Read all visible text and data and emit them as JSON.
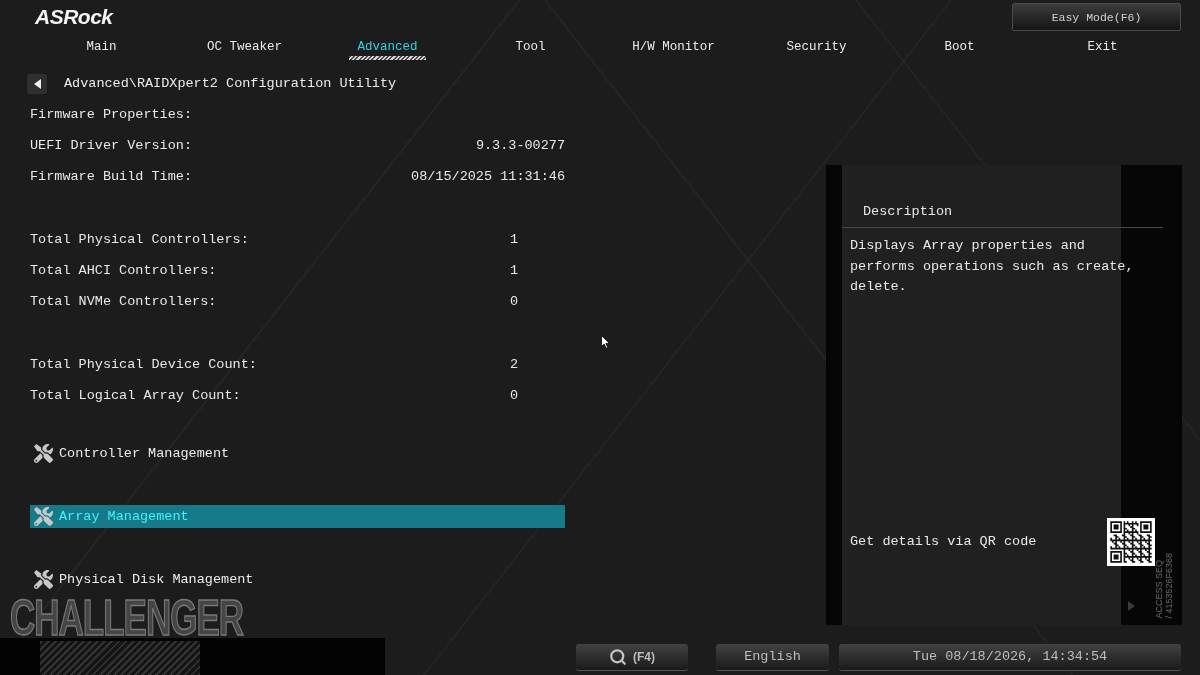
{
  "header": {
    "logo": "ASRock",
    "mode_button": "Easy Mode(F6)"
  },
  "tabs": [
    {
      "label": "Main",
      "selected": false
    },
    {
      "label": "OC Tweaker",
      "selected": false
    },
    {
      "label": "Advanced",
      "selected": true
    },
    {
      "label": "Tool",
      "selected": false
    },
    {
      "label": "H/W Monitor",
      "selected": false
    },
    {
      "label": "Security",
      "selected": false
    },
    {
      "label": "Boot",
      "selected": false
    },
    {
      "label": "Exit",
      "selected": false
    }
  ],
  "breadcrumb": {
    "path": "Advanced\\RAIDXpert2 Configuration Utility"
  },
  "sections": [
    {
      "rows": [
        {
          "label": "Firmware Properties:"
        },
        {
          "label": "UEFI Driver Version:",
          "value": "9.3.3-00277"
        },
        {
          "label": "Firmware Build Time:",
          "value": "08/15/2025 11:31:46"
        }
      ]
    },
    {
      "rows": [
        {
          "label": "Total Physical Controllers:",
          "value": "1"
        },
        {
          "label": "Total AHCI Controllers:",
          "value": "1"
        },
        {
          "label": "Total NVMe Controllers:",
          "value": "0"
        }
      ]
    },
    {
      "rows": [
        {
          "label": "Total Physical Device Count:",
          "value": "2"
        },
        {
          "label": "Total Logical Array Count:",
          "value": "0"
        }
      ]
    }
  ],
  "menu_items": [
    {
      "label": "Controller Management",
      "selected": false
    },
    {
      "label": "Array Management",
      "selected": true
    },
    {
      "label": "Physical Disk Management",
      "selected": false
    }
  ],
  "series_logo": "CHALLENGER",
  "description": {
    "title": "Description",
    "text": "Displays Array properties and performs operations such as create, delete.",
    "qr_label": "Get details via QR code",
    "access_seq": [
      "ACCESS SEQ",
      "/ 4153526F6368"
    ]
  },
  "footer": {
    "search_key": "(F4)",
    "language": "English",
    "datetime": "Tue 08/18/2026, 14:34:54"
  }
}
